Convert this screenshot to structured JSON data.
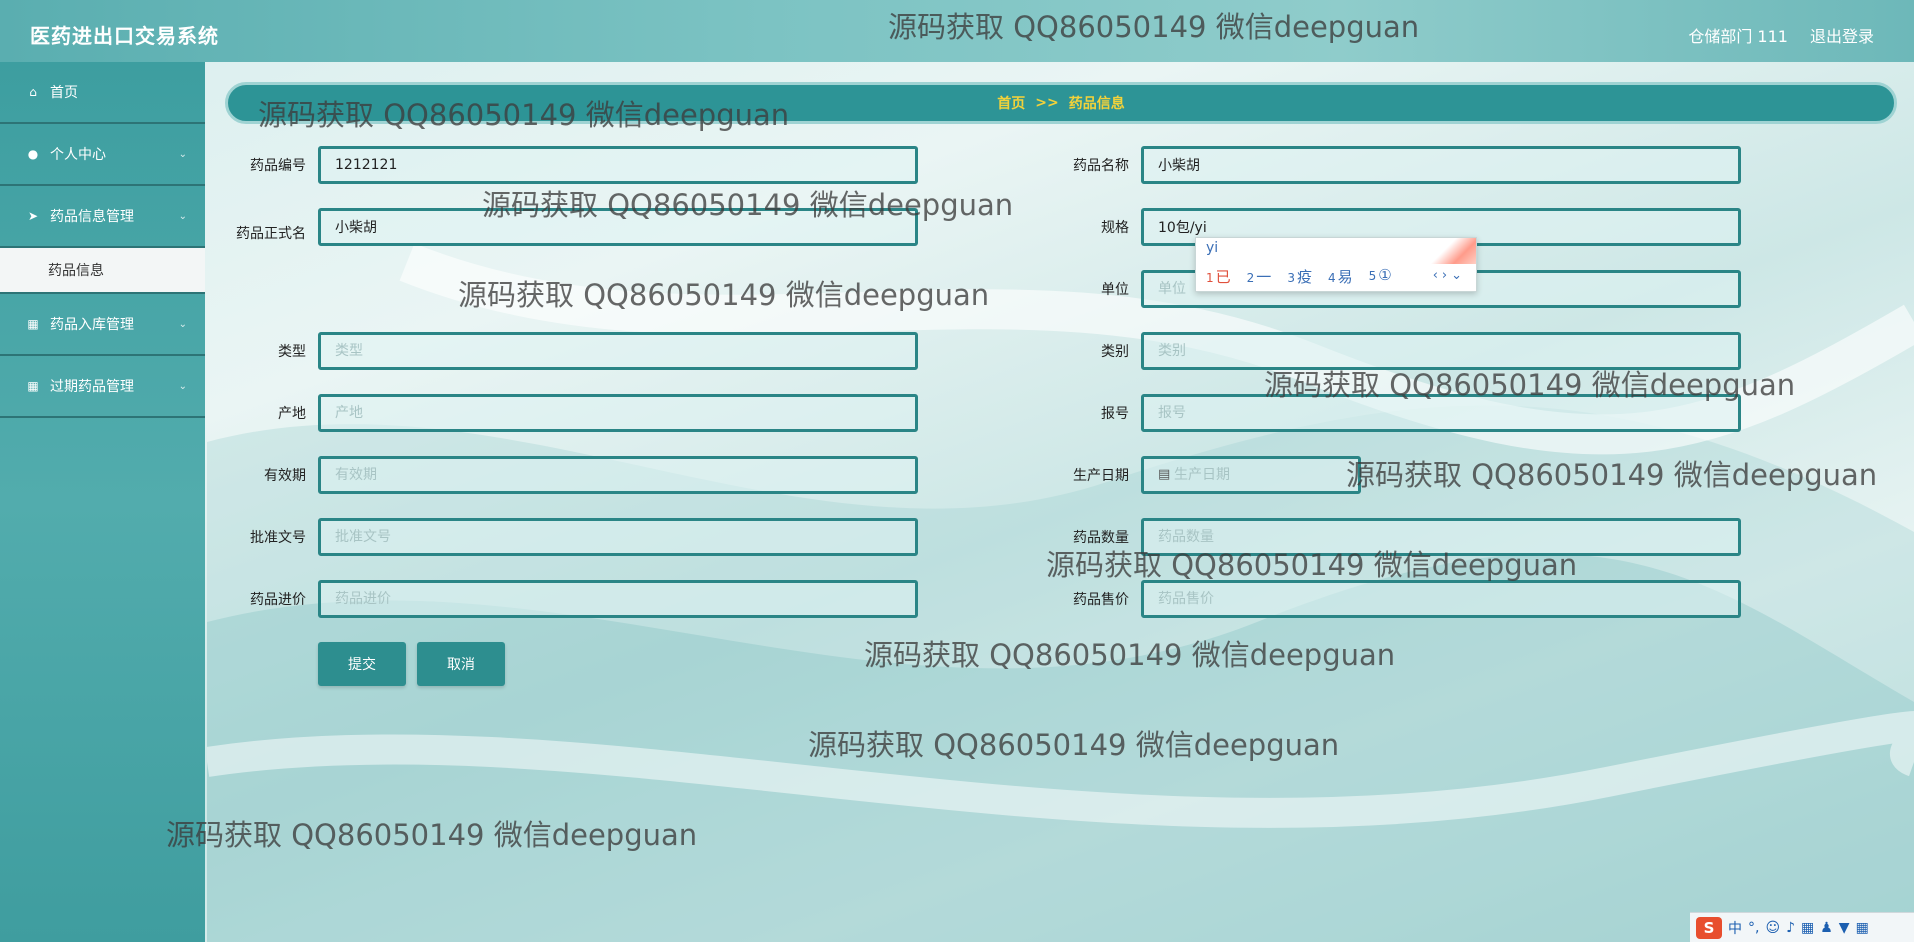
{
  "app": {
    "title": "医药进出口交易系统"
  },
  "header": {
    "user": "仓储部门 111",
    "logout": "退出登录"
  },
  "sidebar": {
    "items": [
      {
        "label": "首页",
        "icon": "home-icon"
      },
      {
        "label": "个人中心",
        "icon": "user-icon"
      },
      {
        "label": "药品信息管理",
        "icon": "paper-plane-icon"
      },
      {
        "label": "药品入库管理",
        "icon": "grid-icon"
      },
      {
        "label": "过期药品管理",
        "icon": "grid-icon"
      }
    ],
    "sub_item": "药品信息"
  },
  "breadcrumb": {
    "home": "首页",
    "sep": ">>",
    "current": "药品信息"
  },
  "form": {
    "left": [
      {
        "label": "药品编号",
        "value": "1212121",
        "placeholder": ""
      },
      {
        "label": "药品正式名",
        "value": "小柴胡",
        "placeholder": ""
      },
      {
        "label": "类型",
        "value": "",
        "placeholder": "类型"
      },
      {
        "label": "产地",
        "value": "",
        "placeholder": "产地"
      },
      {
        "label": "有效期",
        "value": "",
        "placeholder": "有效期"
      },
      {
        "label": "批准文号",
        "value": "",
        "placeholder": "批准文号"
      },
      {
        "label": "药品进价",
        "value": "",
        "placeholder": "药品进价"
      }
    ],
    "right": [
      {
        "label": "药品名称",
        "value": "小柴胡",
        "placeholder": ""
      },
      {
        "label": "规格",
        "value": "10包/yi",
        "placeholder": ""
      },
      {
        "label": "单位",
        "value": "",
        "placeholder": "单位"
      },
      {
        "label": "类别",
        "value": "",
        "placeholder": "类别"
      },
      {
        "label": "报号",
        "value": "",
        "placeholder": "报号"
      },
      {
        "label": "生产日期",
        "value": "",
        "placeholder": "生产日期"
      },
      {
        "label": "药品数量",
        "value": "",
        "placeholder": "药品数量"
      },
      {
        "label": "药品售价",
        "value": "",
        "placeholder": "药品售价"
      }
    ],
    "submit": "提交",
    "cancel": "取消"
  },
  "ime": {
    "composition": "yi",
    "candidates": [
      {
        "num": "1",
        "text": "已"
      },
      {
        "num": "2",
        "text": "一"
      },
      {
        "num": "3",
        "text": "疫"
      },
      {
        "num": "4",
        "text": "易"
      },
      {
        "num": "5",
        "text": "①"
      }
    ]
  },
  "watermark": "源码获取 QQ86050149 微信deepguan",
  "tray": {
    "lang": "中"
  }
}
